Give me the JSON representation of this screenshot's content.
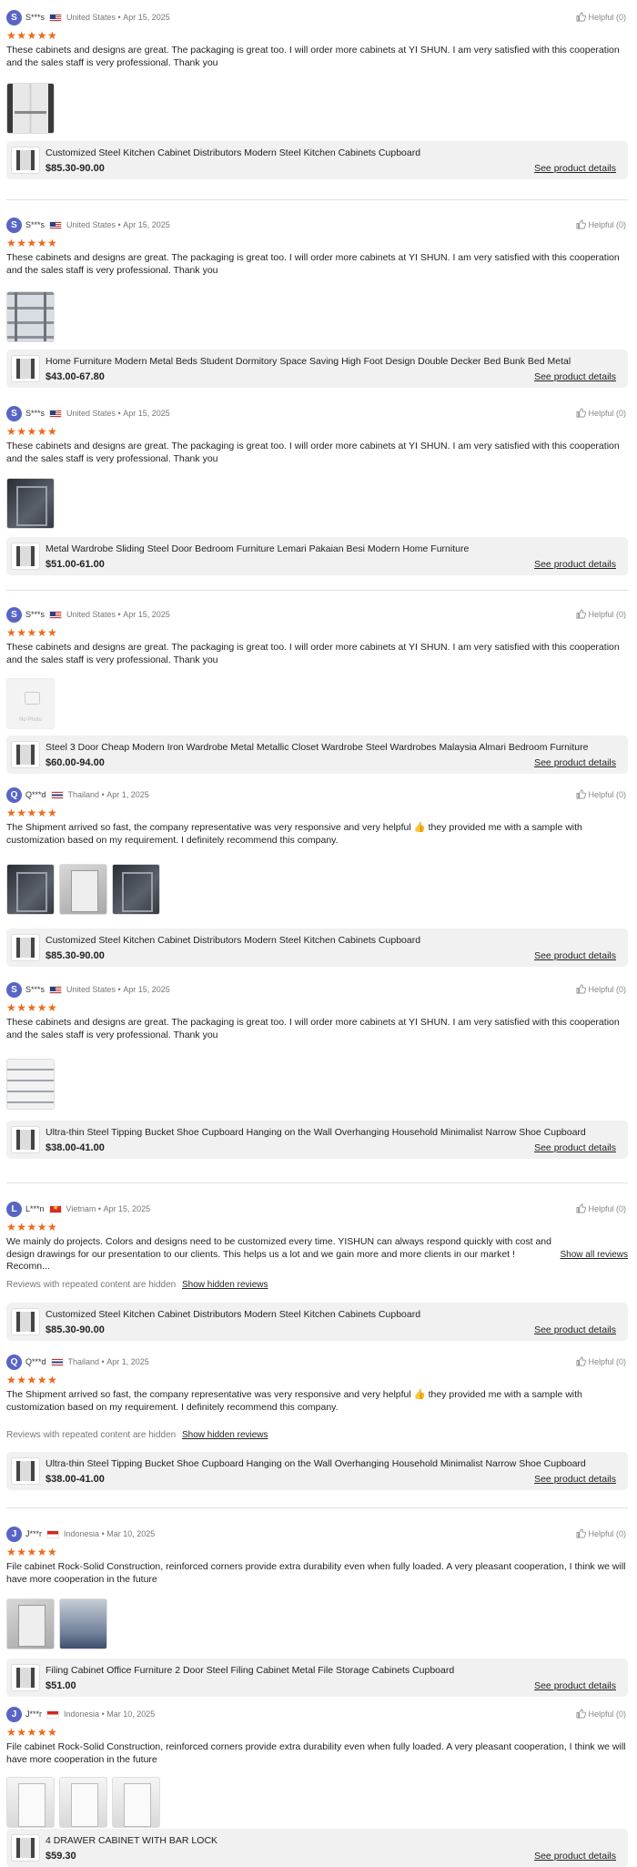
{
  "helpful_label": "Helpful (0)",
  "see_details_label": "See product details",
  "hidden_notice": "Reviews with repeated content are hidden",
  "show_hidden_label": "Show hidden reviews",
  "show_all_label": "Show all reviews",
  "colors": {
    "star": "#ee6a1a",
    "avatar": "#5865c6",
    "card_bg": "#f1f1f1"
  },
  "reviews": [
    {
      "initial": "S",
      "name": "S***s",
      "country": "United States",
      "date": "Apr 15, 2025",
      "stars": "★★★★★",
      "text": "These cabinets and designs are great. The packaging is great too. I will order more cabinets at YI SHUN. I am very satisfied with this cooperation and the sales staff is very professional. Thank you",
      "product": {
        "name": "Customized Steel Kitchen Cabinet Distributors Modern Steel Kitchen Cabinets Cupboard",
        "price": "$85.30-90.00"
      }
    },
    {
      "initial": "S",
      "name": "S***s",
      "country": "United States",
      "date": "Apr 15, 2025",
      "stars": "★★★★★",
      "text": "These cabinets and designs are great. The packaging is great too. I will order more cabinets at YI SHUN. I am very satisfied with this cooperation and the sales staff is very professional. Thank you",
      "product": {
        "name": "Home Furniture Modern Metal Beds Student Dormitory Space Saving High Foot Design Double Decker Bed Bunk Bed Metal",
        "price": "$43.00-67.80"
      }
    },
    {
      "initial": "S",
      "name": "S***s",
      "country": "United States",
      "date": "Apr 15, 2025",
      "stars": "★★★★★",
      "text": "These cabinets and designs are great. The packaging is great too. I will order more cabinets at YI SHUN. I am very satisfied with this cooperation and the sales staff is very professional. Thank you",
      "product": {
        "name": "Metal Wardrobe Sliding Steel Door Bedroom Furniture Lemari Pakaian Besi Modern Home Furniture",
        "price": "$51.00-61.00"
      }
    },
    {
      "initial": "S",
      "name": "S***s",
      "country": "United States",
      "date": "Apr 15, 2025",
      "stars": "★★★★★",
      "text": "These cabinets and designs are great. The packaging is great too. I will order more cabinets at YI SHUN. I am very satisfied with this cooperation and the sales staff is very professional. Thank you",
      "product": {
        "name": "Steel 3 Door Cheap Modern Iron Wardrobe Metal Metallic Closet Wardrobe Steel Wardrobes Malaysia Almari Bedroom Furniture",
        "price": "$60.00-94.00"
      }
    },
    {
      "initial": "Q",
      "name": "Q***d",
      "country": "Thailand",
      "date": "Apr 1, 2025",
      "stars": "★★★★★",
      "text": "The Shipment arrived so fast, the company representative was very responsive and very helpful 👍 they provided me with a sample with customization based on my requirement. I definitely recommend this company.",
      "product": {
        "name": "Customized Steel Kitchen Cabinet Distributors Modern Steel Kitchen Cabinets Cupboard",
        "price": "$85.30-90.00"
      }
    },
    {
      "initial": "S",
      "name": "S***s",
      "country": "United States",
      "date": "Apr 15, 2025",
      "stars": "★★★★★",
      "text": "These cabinets and designs are great. The packaging is great too. I will order more cabinets at YI SHUN. I am very satisfied with this cooperation and the sales staff is very professional. Thank you",
      "product": {
        "name": "Ultra-thin Steel Tipping Bucket Shoe Cupboard Hanging on the Wall Overhanging Household Minimalist Narrow Shoe Cupboard",
        "price": "$38.00-41.00"
      }
    },
    {
      "initial": "L",
      "name": "L***n",
      "country": "Vietnam",
      "date": "Apr 15, 2025",
      "stars": "★★★★★",
      "text": "We mainly do projects. Colors and designs need to be customized every time. YISHUN can always respond quickly with cost and design drawings for our presentation to our clients. This helps us a lot and we gain more and more clients in our market ! Recomn...",
      "product": {
        "name": "Customized Steel Kitchen Cabinet Distributors Modern Steel Kitchen Cabinets Cupboard",
        "price": "$85.30-90.00"
      }
    },
    {
      "initial": "Q",
      "name": "Q***d",
      "country": "Thailand",
      "date": "Apr 1, 2025",
      "stars": "★★★★★",
      "text": "The Shipment arrived so fast, the company representative was very responsive and very helpful 👍 they provided me with a sample with customization based on my requirement. I definitely recommend this company.",
      "product": {
        "name": "Ultra-thin Steel Tipping Bucket Shoe Cupboard Hanging on the Wall Overhanging Household Minimalist Narrow Shoe Cupboard",
        "price": "$38.00-41.00"
      }
    },
    {
      "initial": "J",
      "name": "J***r",
      "country": "Indonesia",
      "date": "Mar 10, 2025",
      "stars": "★★★★★",
      "text": "File cabinet Rock-Solid Construction, reinforced corners provide extra durability even when fully loaded. A very pleasant cooperation, I think we will have more cooperation in the future",
      "product": {
        "name": "Filing Cabinet Office Furniture 2 Door Steel Filing Cabinet Metal File Storage Cabinets Cupboard",
        "price": "$51.00"
      }
    },
    {
      "initial": "J",
      "name": "J***r",
      "country": "Indonesia",
      "date": "Mar 10, 2025",
      "stars": "★★★★★",
      "text": "File cabinet Rock-Solid Construction, reinforced corners provide extra durability even when fully loaded. A very pleasant cooperation, I think we will have more cooperation in the future",
      "product": {
        "name": "4 DRAWER CABINET WITH BAR LOCK",
        "price": "$59.30"
      }
    }
  ]
}
